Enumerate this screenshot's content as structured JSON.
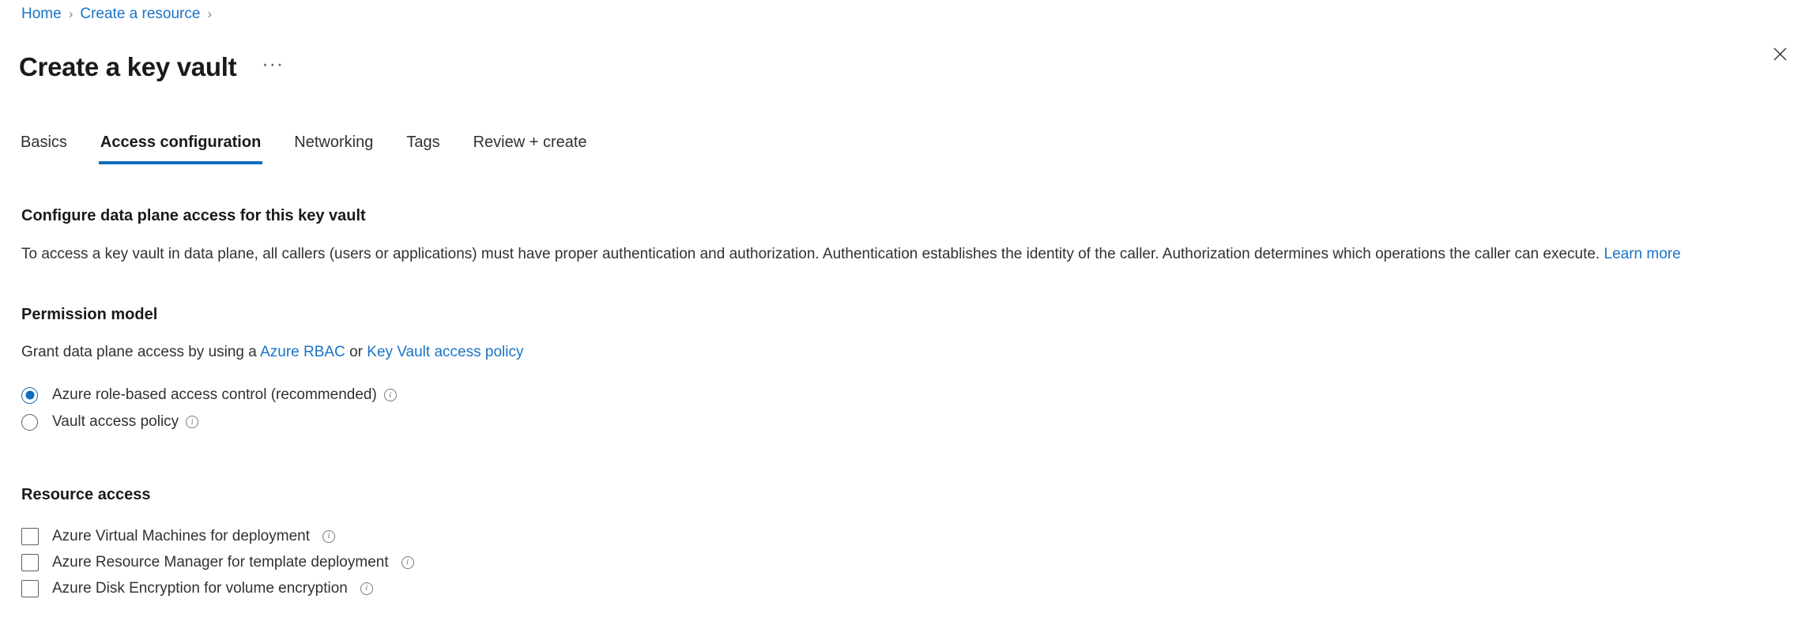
{
  "breadcrumb": {
    "items": [
      {
        "label": "Home"
      },
      {
        "label": "Create a resource"
      }
    ],
    "separator": "›"
  },
  "header": {
    "title": "Create a key vault",
    "more_label": "···",
    "close_label": "✕"
  },
  "tabs": [
    {
      "label": "Basics",
      "active": false
    },
    {
      "label": "Access configuration",
      "active": true
    },
    {
      "label": "Networking",
      "active": false
    },
    {
      "label": "Tags",
      "active": false
    },
    {
      "label": "Review + create",
      "active": false
    }
  ],
  "main": {
    "configure_heading": "Configure data plane access for this key vault",
    "description": {
      "text": "To access a key vault in data plane, all callers (users or applications) must have proper authentication and authorization. Authentication establishes the identity of the caller. Authorization determines which operations the caller can execute.",
      "link": "Learn more"
    },
    "permission_model": {
      "heading": "Permission model",
      "intro_prefix": "Grant data plane access by using a",
      "link_rbac": "Azure RBAC",
      "intro_conjunction": "or",
      "link_policy": "Key Vault access policy",
      "options": [
        {
          "label": "Azure role-based access control (recommended)",
          "selected": true,
          "info": "і"
        },
        {
          "label": "Vault access policy",
          "selected": false,
          "info": "і"
        }
      ]
    },
    "resource_access": {
      "heading": "Resource access",
      "options": [
        {
          "label": "Azure Virtual Machines for deployment",
          "checked": false
        },
        {
          "label": "Azure Resource Manager for template deployment",
          "checked": false
        },
        {
          "label": "Azure Disk Encryption for volume encryption",
          "checked": false
        }
      ]
    }
  },
  "colors": {
    "accent": "#0f6cbd",
    "link": "#1a73c7",
    "text": "#323130",
    "heading": "#1b1a19",
    "border": "#605e5c"
  }
}
